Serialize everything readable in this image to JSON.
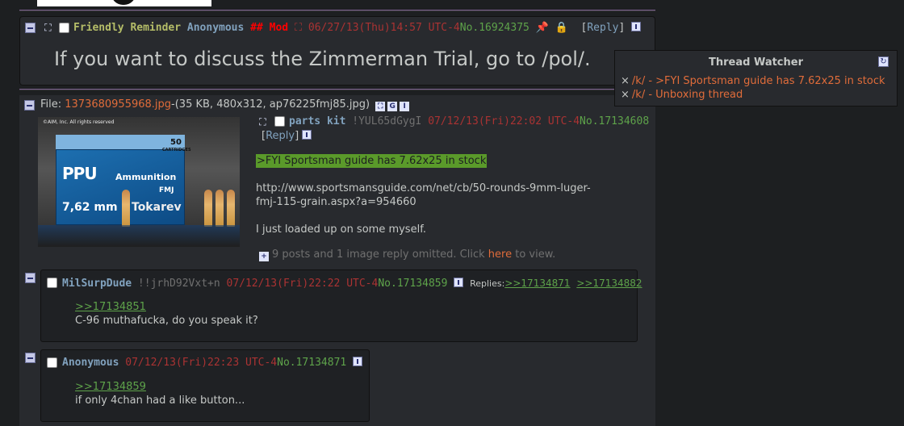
{
  "sticky": {
    "subject": "Friendly Reminder",
    "name": "Anonymous",
    "capcode": "## Mod",
    "date": "06/27/13(Thu)14:57 UTC-4",
    "postnum": "No.16924375",
    "reply_open": "[",
    "reply_label": "Reply",
    "reply_close": "]",
    "message": "If you want to discuss the Zimmerman Trial, go to /pol/."
  },
  "op": {
    "file_prefix": "File: ",
    "file_name": "1373680955968.jpg",
    "file_info": "-(35 KB, 480x312, ap76225fmj85.jpg)",
    "thumb": {
      "copyright": "©AIM, Inc. All rights reserved",
      "box_count": "50",
      "box_cartridges": "CARTRIDGES",
      "brand": "PPU",
      "product": "Ammunition",
      "caliber": "7,62 mm",
      "type": "Tokarev",
      "fmj": "FMJ"
    },
    "subject": "parts kit",
    "trip": "!YUL65dGygI",
    "date": "07/12/13(Fri)22:02 UTC-4",
    "postnum": "No.17134608",
    "reply_open": "[",
    "reply_label": "Reply",
    "reply_close": "]",
    "quote": ">FYI Sportsman guide has 7.62x25 in stock",
    "url_line1": "http://www.sportsmansguide.com/net/cb/50-rounds-9mm-luger-",
    "url_line2": "fmj-115-grain.aspx?a=954660",
    "body": "I just loaded up on some myself.",
    "omitted_pre": "9 posts and 1 image reply omitted. Click ",
    "omitted_link": "here",
    "omitted_post": " to view."
  },
  "replies": [
    {
      "name": "MilSurpDude",
      "trip": "!!jrhD92Vxt+n",
      "date": "07/12/13(Fri)22:22 UTC-4",
      "postnum": "No.17134859",
      "replies_label": "Replies:",
      "backlinks": [
        ">>17134871",
        ">>17134882"
      ],
      "quote": ">>17134851",
      "body": "C-96 muthafucka, do you speak it?"
    },
    {
      "name": "Anonymous",
      "date": "07/12/13(Fri)22:23 UTC-4",
      "postnum": "No.17134871",
      "quote": ">>17134859",
      "body": "if only 4chan had a like button..."
    }
  ],
  "watcher": {
    "title": "Thread Watcher",
    "items": [
      "/k/ - >FYI Sportsman guide has 7.62x25 in stock",
      "/k/ - Unboxing thread"
    ]
  },
  "colors": {
    "background": "#1d1f21",
    "post_bg": "#282a2e",
    "subject": "#b5bd68",
    "name": "#81a2be",
    "date": "#aa3333",
    "postnum": "#5ea34a",
    "link": "#e06c3a",
    "mod": "#ff0000"
  }
}
